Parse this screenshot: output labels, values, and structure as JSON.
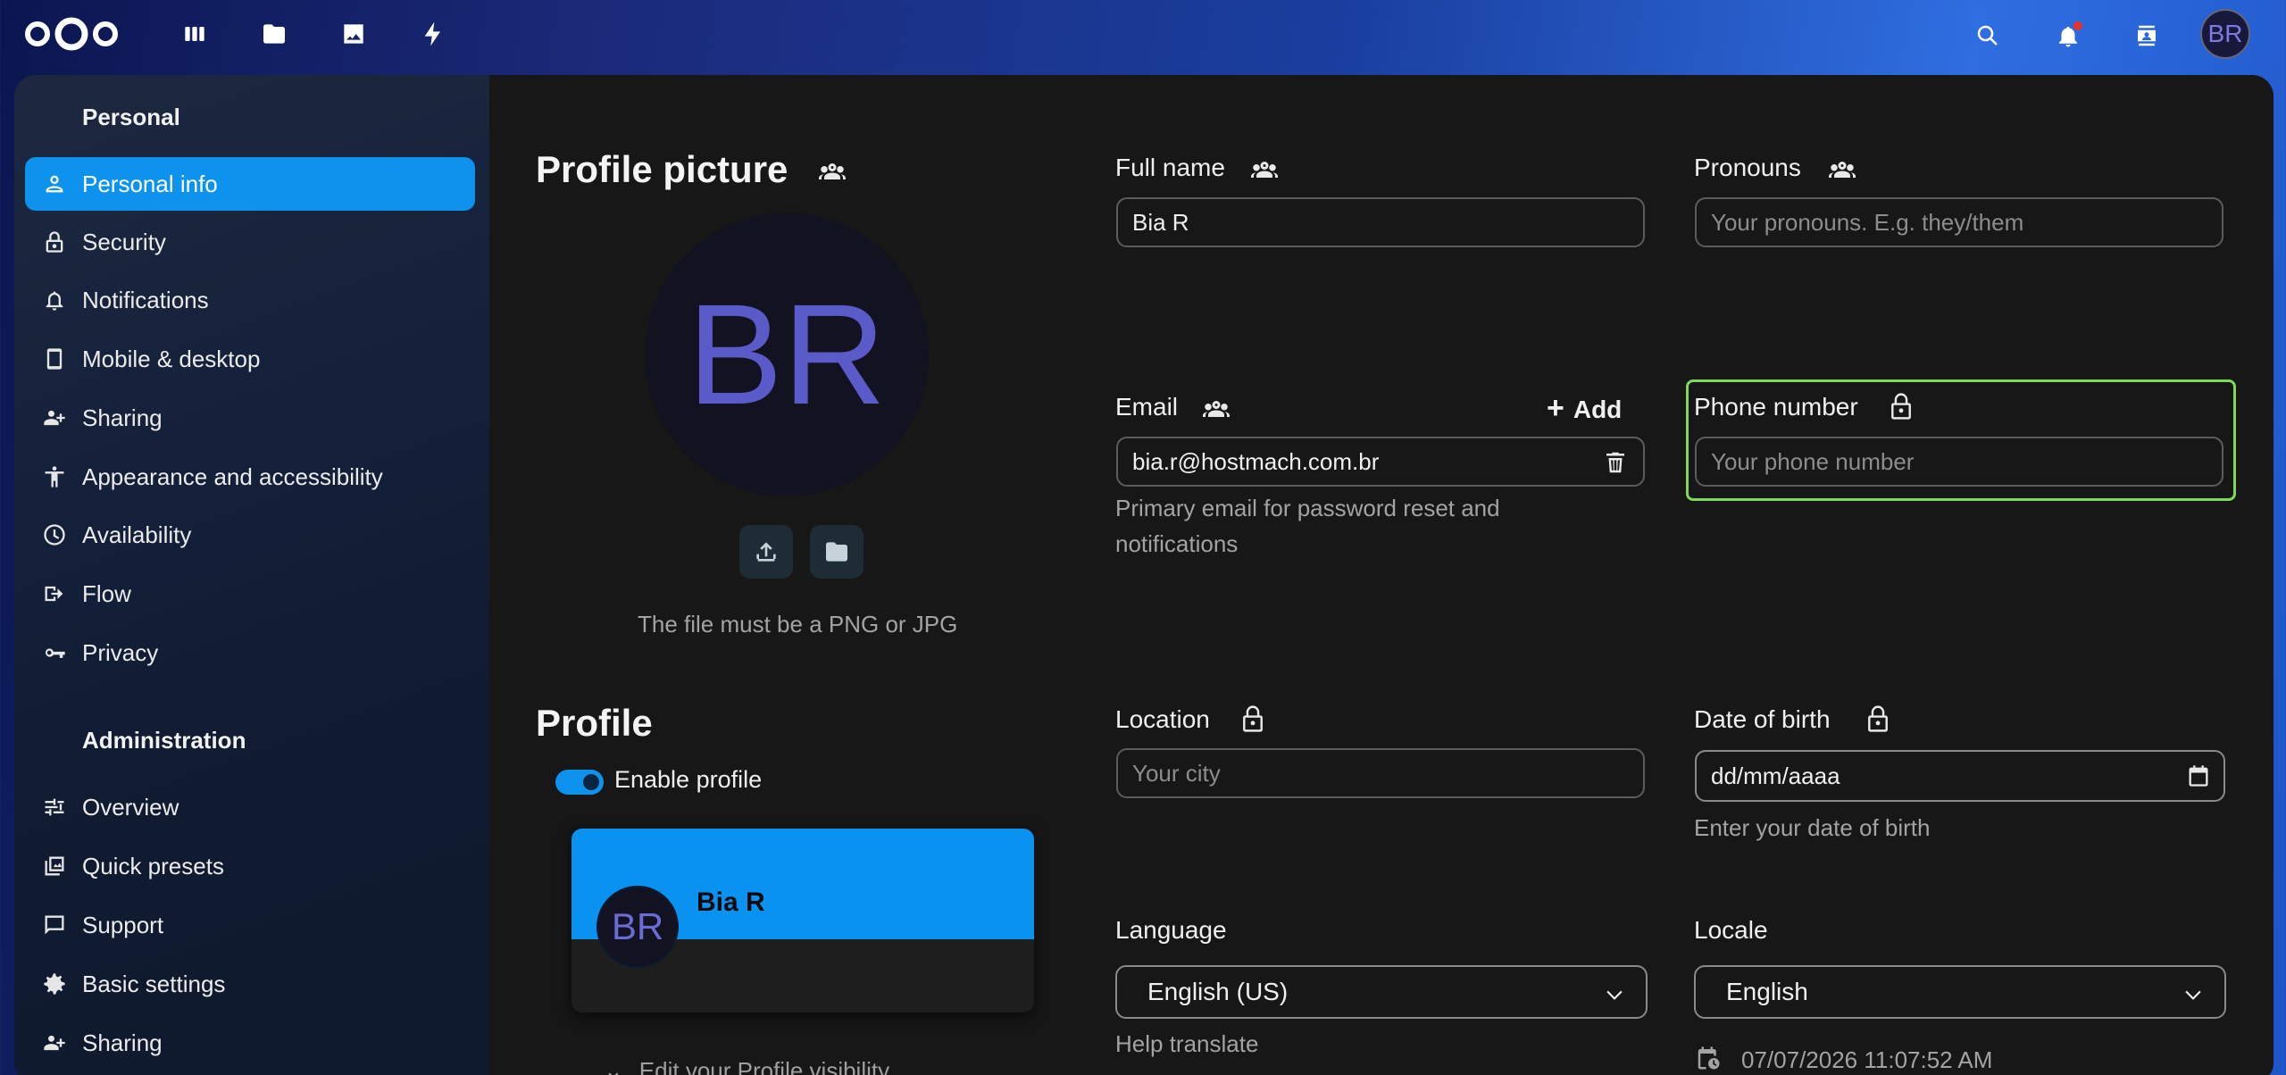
{
  "topbar": {
    "apps": [
      "dashboard-icon",
      "files-icon",
      "photos-icon",
      "activity-icon"
    ],
    "right_icons": [
      "search-icon",
      "notifications-icon",
      "contacts-icon"
    ],
    "user_initials": "BR"
  },
  "sidebar": {
    "personal_heading": "Personal",
    "personal_items": [
      {
        "label": "Personal info",
        "icon": "user-icon",
        "active": true
      },
      {
        "label": "Security",
        "icon": "lock-icon"
      },
      {
        "label": "Notifications",
        "icon": "bell-icon"
      },
      {
        "label": "Mobile & desktop",
        "icon": "phone-icon"
      },
      {
        "label": "Sharing",
        "icon": "share-icon"
      },
      {
        "label": "Appearance and accessibility",
        "icon": "accessibility-icon"
      },
      {
        "label": "Availability",
        "icon": "clock-icon"
      },
      {
        "label": "Flow",
        "icon": "flow-icon"
      },
      {
        "label": "Privacy",
        "icon": "key-icon"
      }
    ],
    "admin_heading": "Administration",
    "admin_items": [
      {
        "label": "Overview",
        "icon": "sliders-icon"
      },
      {
        "label": "Quick presets",
        "icon": "presets-icon"
      },
      {
        "label": "Support",
        "icon": "support-icon"
      },
      {
        "label": "Basic settings",
        "icon": "gear-icon"
      },
      {
        "label": "Sharing",
        "icon": "share-icon"
      }
    ]
  },
  "profile_picture": {
    "title": "Profile picture",
    "initials": "BR",
    "hint": "The file must be a PNG or JPG"
  },
  "profile": {
    "title": "Profile",
    "enable_label": "Enable profile",
    "enabled": true,
    "card_initials": "BR",
    "card_name": "Bia R",
    "edit_visibility": "Edit your Profile visibility"
  },
  "fields": {
    "full_name": {
      "label": "Full name",
      "value": "Bia R"
    },
    "pronouns": {
      "label": "Pronouns",
      "placeholder": "Your pronouns. E.g. they/them"
    },
    "email": {
      "label": "Email",
      "add_label": "Add",
      "value": "bia.r@hostmach.com.br",
      "help_line1": "Primary email for password reset and",
      "help_line2": "notifications"
    },
    "phone": {
      "label": "Phone number",
      "placeholder": "Your phone number"
    },
    "location": {
      "label": "Location",
      "placeholder": "Your city"
    },
    "birth": {
      "label": "Date of birth",
      "value": "dd/mm/aaaa",
      "help": "Enter your date of birth"
    },
    "language": {
      "label": "Language",
      "value": "English (US)",
      "help": "Help translate"
    },
    "locale": {
      "label": "Locale",
      "value": "English",
      "timestamp": "07/07/2026 11:07:52 AM"
    }
  },
  "colors": {
    "accent": "#0d93ee",
    "highlight": "#7ed957"
  }
}
